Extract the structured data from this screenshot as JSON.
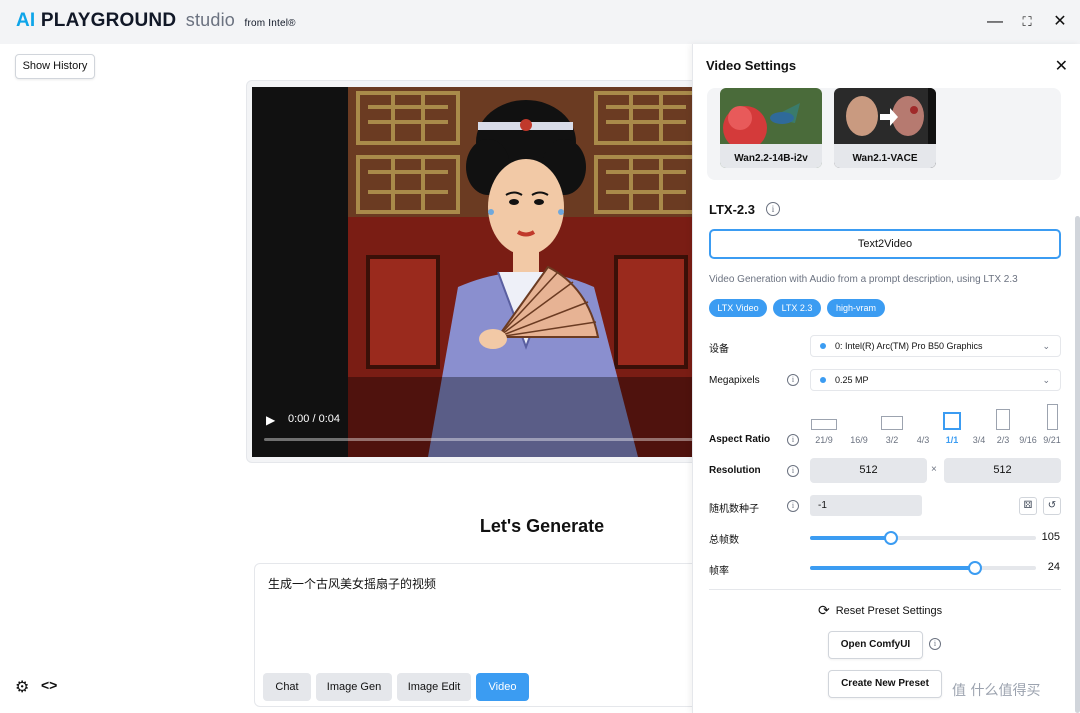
{
  "app": {
    "brand_ai": "AI",
    "brand_playground": "PLAYGROUND",
    "brand_studio": "studio",
    "brand_from": "from Intel®"
  },
  "window_controls": {
    "minimize": "—",
    "maximize": "⛶",
    "close": "✕"
  },
  "sidebar": {
    "show_history_label": "Show History"
  },
  "video": {
    "time": "0:00 / 0:04",
    "progress": 0.0
  },
  "main": {
    "heading": "Let's Generate",
    "prompt_text": "生成一个古风美女摇扇子的视频",
    "modes": [
      {
        "label": "Chat",
        "active": false
      },
      {
        "label": "Image Gen",
        "active": false
      },
      {
        "label": "Image Edit",
        "active": false
      },
      {
        "label": "Video",
        "active": true
      }
    ]
  },
  "settings": {
    "title": "Video Settings",
    "models": [
      {
        "label": "Wan2.2-14B-i2v"
      },
      {
        "label": "Wan2.1-VACE"
      }
    ],
    "model_name": "LTX-2.3",
    "mode": "Text2Video",
    "description": "Video Generation with Audio from a prompt description, using LTX 2.3",
    "tags": [
      "LTX Video",
      "LTX 2.3",
      "high-vram"
    ],
    "device_label": "设备",
    "device_value": "0: Intel(R) Arc(TM) Pro B50 Graphics",
    "megapixels_label": "Megapixels",
    "megapixels_value": "0.25 MP",
    "aspect_label": "Aspect Ratio",
    "aspect_options": [
      "21/9",
      "16/9",
      "3/2",
      "4/3",
      "1/1",
      "3/4",
      "2/3",
      "9/16",
      "9/21"
    ],
    "aspect_selected": "1/1",
    "resolution_label": "Resolution",
    "resolution_width": "512",
    "resolution_x": "×",
    "resolution_height": "512",
    "seed_label": "随机数种子",
    "seed_value": "-1",
    "frames_label": "总帧数",
    "frames_value": "105",
    "frames_fraction": 0.36,
    "fps_label": "帧率",
    "fps_value": "24",
    "fps_fraction": 0.73,
    "reset_label": "Reset Preset Settings",
    "open_comfy_label": "Open ComfyUI",
    "create_preset_label": "Create New Preset",
    "accent": "#3b9cf2"
  },
  "watermark": "值 什么值得买"
}
